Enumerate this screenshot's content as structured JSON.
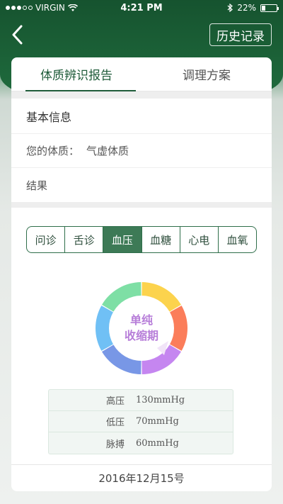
{
  "status_bar": {
    "carrier": "VIRGIN",
    "time": "4:21 PM",
    "battery": "22%"
  },
  "header": {
    "back_icon": "chevron-left-icon",
    "history_label": "历史记录"
  },
  "tabs": [
    {
      "label": "体质辨识报告",
      "active": true
    },
    {
      "label": "调理方案",
      "active": false
    }
  ],
  "basic_info": {
    "title": "基本信息",
    "constitution_label": "您的体质：",
    "constitution_value": "气虚体质",
    "result_label": "结果"
  },
  "segments": [
    {
      "label": "问诊",
      "active": false
    },
    {
      "label": "舌诊",
      "active": false
    },
    {
      "label": "血压",
      "active": true
    },
    {
      "label": "血糖",
      "active": false
    },
    {
      "label": "心电",
      "active": false
    },
    {
      "label": "血氧",
      "active": false
    }
  ],
  "donut": {
    "line1": "单纯",
    "line2": "收缩期",
    "segment_colors": [
      "#fcd34d",
      "#fb7d5a",
      "#c586f0",
      "#7897e6",
      "#70c0f5",
      "#7edfa5"
    ],
    "label_color": "#b77ed9"
  },
  "bp": [
    {
      "label": "高压",
      "value": "130mmHg"
    },
    {
      "label": "低压",
      "value": "70mmHg"
    },
    {
      "label": "脉搏",
      "value": "60mmHg"
    }
  ],
  "date": "2016年12月15号",
  "colors": {
    "brand_green": "#1f5c3a",
    "segment_active": "#3d7a56"
  }
}
